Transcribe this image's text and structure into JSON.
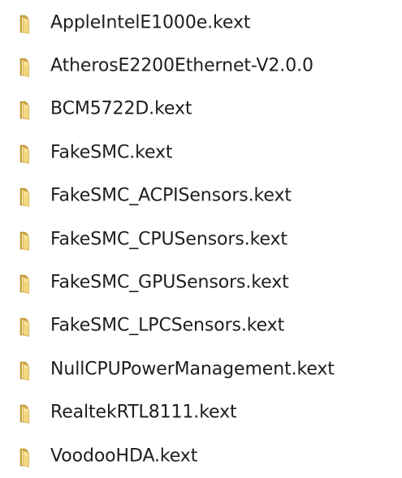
{
  "folder_list": {
    "items": [
      {
        "name": "AppleIntelE1000e.kext",
        "icon": "folder-icon"
      },
      {
        "name": "AtherosE2200Ethernet-V2.0.0",
        "icon": "folder-icon"
      },
      {
        "name": "BCM5722D.kext",
        "icon": "folder-icon"
      },
      {
        "name": "FakeSMC.kext",
        "icon": "folder-icon"
      },
      {
        "name": "FakeSMC_ACPISensors.kext",
        "icon": "folder-icon"
      },
      {
        "name": "FakeSMC_CPUSensors.kext",
        "icon": "folder-icon"
      },
      {
        "name": "FakeSMC_GPUSensors.kext",
        "icon": "folder-icon"
      },
      {
        "name": "FakeSMC_LPCSensors.kext",
        "icon": "folder-icon"
      },
      {
        "name": "NullCPUPowerManagement.kext",
        "icon": "folder-icon"
      },
      {
        "name": "RealtekRTL8111.kext",
        "icon": "folder-icon"
      },
      {
        "name": "VoodooHDA.kext",
        "icon": "folder-icon"
      }
    ]
  },
  "colors": {
    "folder_body": "#e8c25c",
    "folder_front": "#f3d77e",
    "folder_dark": "#c9a03a",
    "text": "#1e1e1e"
  }
}
